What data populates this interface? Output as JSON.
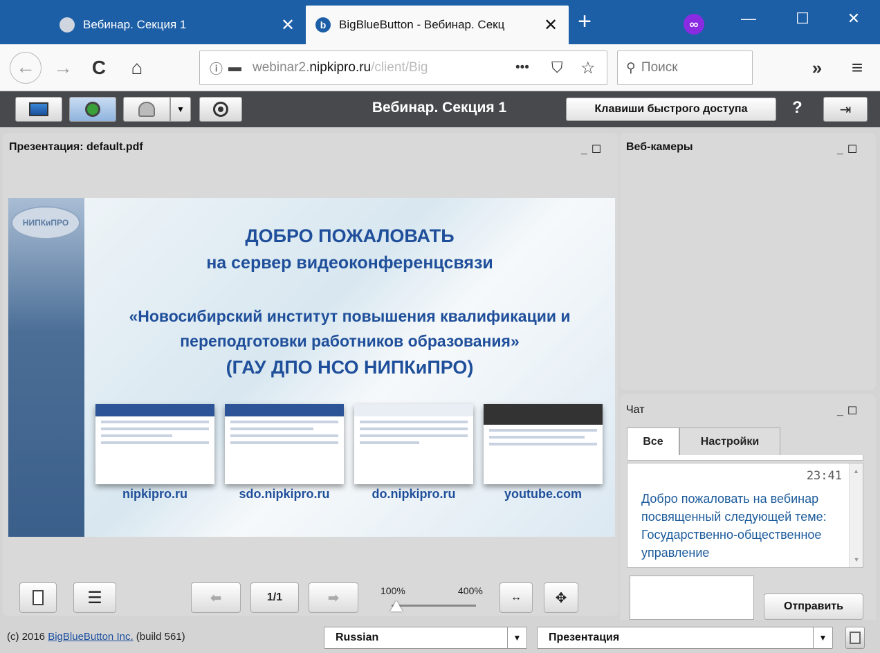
{
  "browser": {
    "tabs": [
      {
        "title": "Вебинар. Секция 1",
        "close": "✕"
      },
      {
        "title": "BigBlueButton - Вебинар. Секц",
        "close": "✕"
      }
    ],
    "new_tab": "+",
    "window_controls": {
      "minimize": "—",
      "maximize": "☐",
      "close": "✕"
    },
    "nav": {
      "back": "←",
      "forward": "→",
      "reload": "C",
      "home": "⌂"
    },
    "url": {
      "prefix": "webinar2.",
      "host": "nipkipro.ru",
      "path": "/client/Big"
    },
    "url_actions": {
      "more": "•••",
      "pocket": "⛉",
      "bookmark": "☆"
    },
    "search_placeholder": "Поиск",
    "overflow": "»",
    "menu": "≡"
  },
  "app_toolbar": {
    "title": "Вебинар. Секция 1",
    "shortcuts_label": "Клавиши быстрого доступа",
    "help": "?"
  },
  "presentation": {
    "title": "Презентация: default.pdf",
    "slide": {
      "emblem": "НИПКиПРО",
      "line1": "ДОБРО ПОЖАЛОВАТЬ",
      "line2": "на сервер видеоконференцсвязи",
      "line3": "«Новосибирский институт повышения квалификации и",
      "line4": "переподготовки работников образования»",
      "line5": "(ГАУ ДПО НСО НИПКиПРО)",
      "sites": [
        "nipkipro.ru",
        "sdo.nipkipro.ru",
        "do.nipkipro.ru",
        "youtube.com"
      ]
    },
    "controls": {
      "page": "1/1",
      "zoom_min": "100%",
      "zoom_max": "400%",
      "zoom_value": 0,
      "fit_width": "↔",
      "move": "✥"
    }
  },
  "webcams": {
    "title": "Веб-камеры"
  },
  "chat": {
    "title": "Чат",
    "tabs": [
      "Все",
      "Настройки"
    ],
    "message": {
      "time": "23:41",
      "text": "Добро пожаловать на вебинар посвященный следующей теме: Государственно-общественное управление"
    },
    "send": "Отправить"
  },
  "footer": {
    "copyright_prefix": "(c) 2016 ",
    "copyright_link": "BigBlueButton Inc.",
    "copyright_suffix": " (build 561)",
    "language": "Russian",
    "layout": "Презентация"
  }
}
